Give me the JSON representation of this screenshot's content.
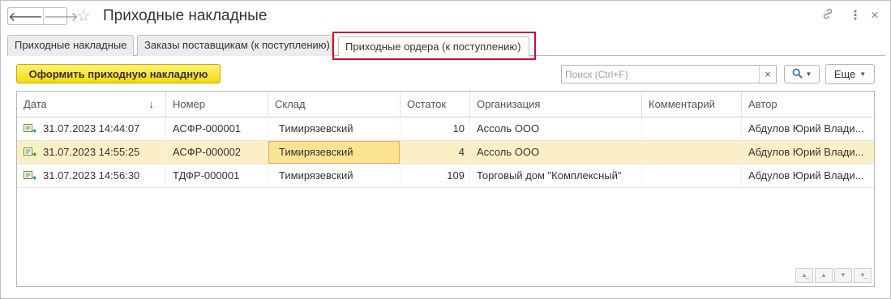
{
  "window": {
    "title": "Приходные накладные",
    "back_icon": "arrow-left-icon",
    "forward_icon": "arrow-right-icon",
    "favorite_icon": "star-icon",
    "link_icon": "link-icon",
    "more_icon": "more-vertical-icon",
    "close_icon": "close-icon"
  },
  "tabs": [
    {
      "label": "Приходные накладные",
      "active": false
    },
    {
      "label": "Заказы поставщикам (к поступлению)",
      "active": false
    },
    {
      "label": "Приходные ордера (к поступлению)",
      "active": true
    }
  ],
  "toolbar": {
    "primary_label": "Оформить приходную накладную",
    "search_placeholder": "Поиск (Ctrl+F)",
    "search_value": "",
    "clear_glyph": "×",
    "more_label": "Еще"
  },
  "table": {
    "columns": [
      "Дата",
      "Номер",
      "Склад",
      "Остаток",
      "Организация",
      "Комментарий",
      "Автор"
    ],
    "sort_glyph": "↓",
    "rows": [
      {
        "date": "31.07.2023 14:44:07",
        "number": "АСФР-000001",
        "warehouse": "Тимирязевский",
        "remainder": "10",
        "organization": "Ассоль ООО",
        "comment": "",
        "author": "Абдулов Юрий Влади..."
      },
      {
        "date": "31.07.2023 14:55:25",
        "number": "АСФР-000002",
        "warehouse": "Тимирязевский",
        "remainder": "4",
        "organization": "Ассоль ООО",
        "comment": "",
        "author": "Абдулов Юрий Влади..."
      },
      {
        "date": "31.07.2023 14:56:30",
        "number": "ТДФР-000001",
        "warehouse": "Тимирязевский",
        "remainder": "109",
        "organization": "Торговый дом \"Комплексный\"",
        "comment": "",
        "author": "Абдулов Юрий Влади..."
      }
    ]
  },
  "colors": {
    "primary_button": "#f5d90a",
    "selected_row": "#fbf0c5",
    "tab_highlight": "#c8102e",
    "search_icon": "#2a6bbf"
  }
}
